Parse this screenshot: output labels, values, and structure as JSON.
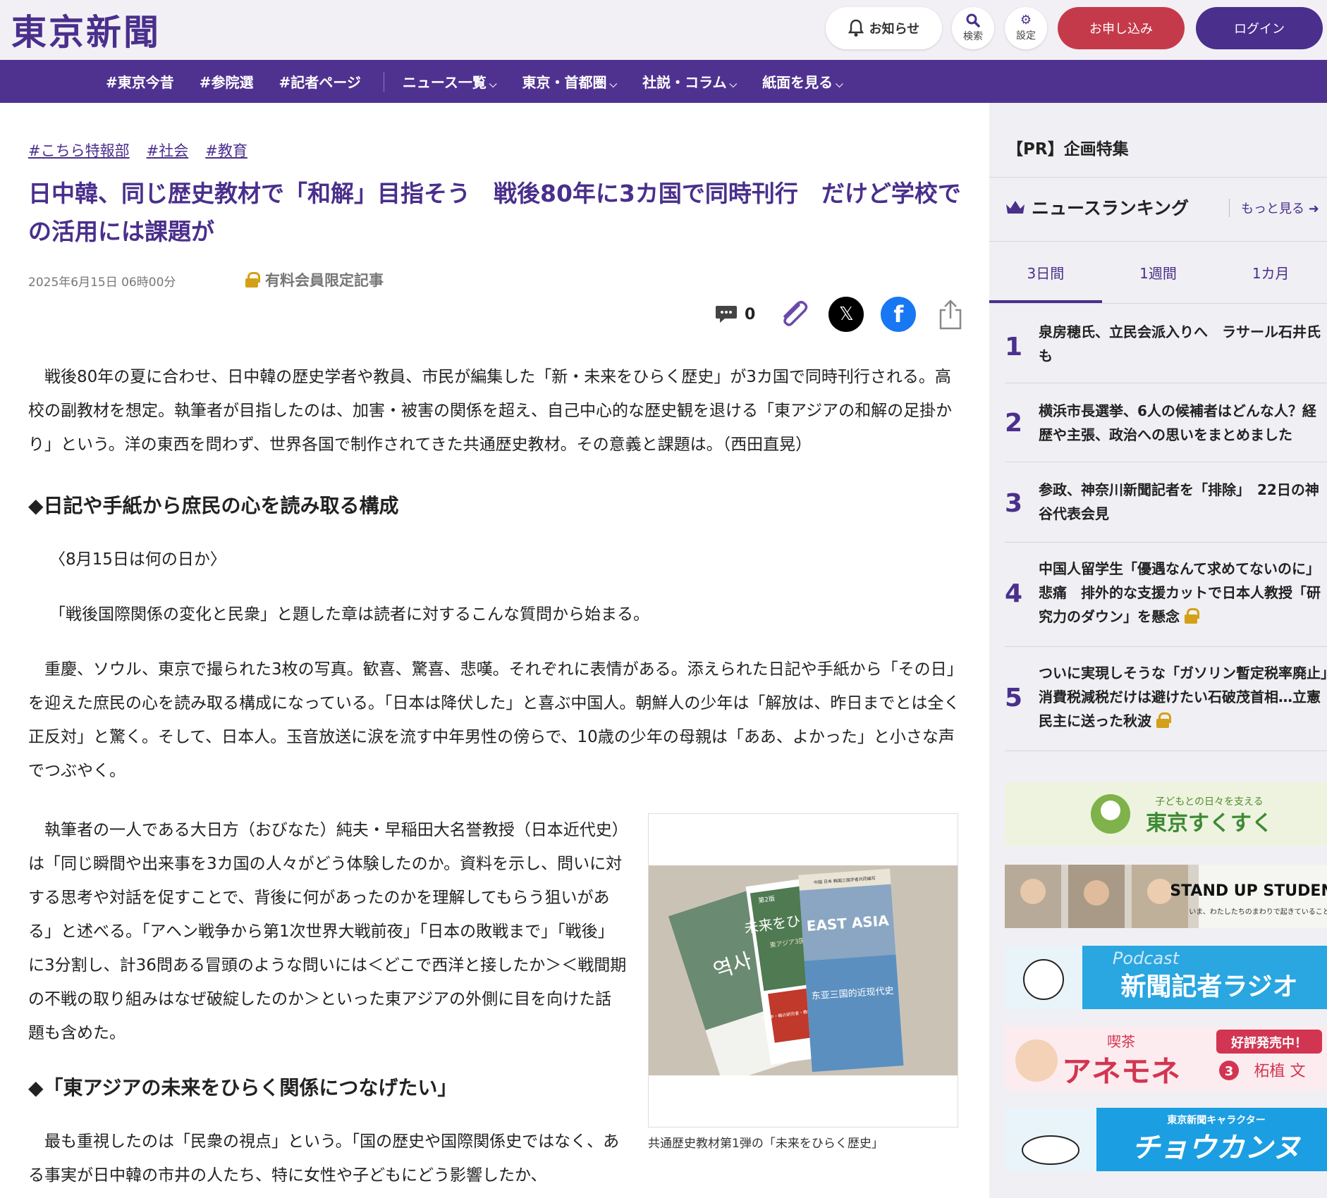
{
  "header": {
    "logo": "東京新聞",
    "notice_label": "お知らせ",
    "search_label": "検索",
    "settings_label": "設定",
    "apply_label": "お申し込み",
    "login_label": "ログイン"
  },
  "nav": {
    "hashtags": [
      "#東京今昔",
      "#参院選",
      "#記者ページ"
    ],
    "menus": [
      "ニュース一覧",
      "東京・首都圏",
      "社説・コラム",
      "紙面を見る"
    ]
  },
  "article": {
    "tags": [
      "#こちら特報部",
      "#社会",
      "#教育"
    ],
    "title": "日中韓、同じ歴史教材で「和解」目指そう　戦後80年に3カ国で同時刊行　だけど学校での活用には課題が",
    "date": "2025年6月15日 06時00分",
    "paid_label": "有料会員限定記事",
    "comment_count": "0",
    "lead": "　戦後80年の夏に合わせ、日中韓の歴史学者や教員、市民が編集した「新・未来をひらく歴史」が3カ国で同時刊行される。高校の副教材を想定。執筆者が目指したのは、加害・被害の関係を超え、自己中心的な歴史観を退ける「東アジアの和解の足掛かり」という。洋の東西を問わず、世界各国で制作されてきた共通歴史教材。その意義と課題は。（西田直晃）",
    "heading1": "◆日記や手紙から庶民の心を読み取る構成",
    "quote": "〈8月15日は何の日か〉",
    "para1": "「戦後国際関係の変化と民衆」と題した章は読者に対するこんな質問から始まる。",
    "para2": "　重慶、ソウル、東京で撮られた3枚の写真。歓喜、驚喜、悲嘆。それぞれに表情がある。添えられた日記や手紙から「その日」を迎えた庶民の心を読み取る構成になっている。「日本は降伏した」と喜ぶ中国人。朝鮮人の少年は「解放は、昨日までとは全く正反対」と驚く。そして、日本人。玉音放送に涙を流す中年男性の傍らで、10歳の少年の母親は「ああ、よかった」と小さな声でつぶやく。",
    "para3": "　執筆者の一人である大日方（おびなた）純夫・早稲田大名誉教授（日本近代史）は「同じ瞬間や出来事を3カ国の人々がどう体験したのか。資料を示し、問いに対する思考や対話を促すことで、背後に何があったのかを理解してもらう狙いがある」と述べる。「アヘン戦争から第1次世界大戦前夜」「日本の敗戦まで」「戦後」に3分割し、計36問ある冒頭のような問いには＜どこで西洋と接したか＞＜戦間期の不戦の取り組みはなぜ破綻したのか＞といった東アジアの外側に目を向けた話題も含めた。",
    "heading2": "◆「東アジアの未来をひらく関係につなげたい」",
    "para4": "　最も重視したのは「民衆の視点」という。「国の歴史や国際関係史ではなく、ある事実が日中韓の市井の人たち、特に女性や子どもにどう影響したか、",
    "caption": "共通歴史教材第1弾の「未来をひらく歴史」",
    "photo_books": {
      "book1": "역사",
      "book2_top": "第2版",
      "book2_title": "未来をひらく歴史",
      "book2_sub": "東アジア3国の近現代史",
      "book2_band": "日・中・韓の研究者・教師らが共同編集",
      "book3_top": "中国 日本 韩国三国学者共同编写",
      "book3_en": "EAST ASIA",
      "book3_title": "东亚三国的近现代史"
    }
  },
  "sidebar": {
    "pr_label": "【PR】企画特集",
    "ranking_title": "ニュースランキング",
    "more_label": "もっと見る",
    "tabs": [
      "3日間",
      "1週間",
      "1カ月"
    ],
    "ranking": [
      {
        "num": "1",
        "text": "泉房穂氏、立民会派入りへ　ラサール石井氏も",
        "locked": false
      },
      {
        "num": "2",
        "text": "横浜市長選挙、6人の候補者はどんな人？経歴や主張、政治への思いをまとめました",
        "locked": false
      },
      {
        "num": "3",
        "text": "参政、神奈川新聞記者を「排除」　22日の神谷代表会見",
        "locked": false
      },
      {
        "num": "4",
        "text": "中国人留学生「優遇なんて求めてないのに」悲痛　排外的な支援カットで日本人教授「研究力のダウン」を懸念",
        "locked": true
      },
      {
        "num": "5",
        "text": "ついに実現しそうな「ガソリン暫定税率廃止」　消費税減税だけは避けたい石破茂首相…立憲民主に送った秋波",
        "locked": true
      }
    ],
    "banners": {
      "b1_small": "子どもとの日々を支える",
      "b1_big": "東京すくすく",
      "b2_big": "STAND UP STUDENTS",
      "b2_small": "いま、わたしたちのまわりで起きていること。",
      "b3_top": "Podcast",
      "b3_big": "新聞記者ラジオ",
      "b4_small": "喫茶",
      "b4_big": "アネモネ",
      "b4_badge": "好評発売中！",
      "b4_num": "3",
      "b4_author": "柘植 文",
      "b5_small": "東京新聞キャラクター",
      "b5_big": "チョウカンヌ"
    }
  },
  "colors": {
    "brand_purple": "#4f3290",
    "apply_red": "#c53a4a",
    "lock_gold": "#d4a017",
    "facebook_blue": "#1877f2"
  }
}
